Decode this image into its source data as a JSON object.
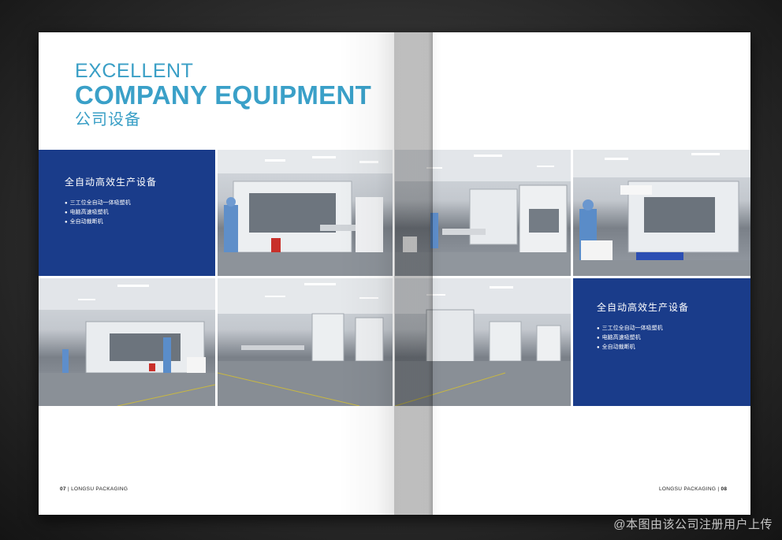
{
  "headline": {
    "line1": "EXCELLENT",
    "line2": "COMPANY EQUIPMENT",
    "line3": "公司设备"
  },
  "panels": [
    {
      "title": "全自动高效生产设备",
      "items": [
        "三工位全自动一体吸塑机",
        "电脑高速吸塑机",
        "全自动裁断机"
      ]
    },
    {
      "title": "全自动高效生产设备",
      "items": [
        "三工位全自动一体吸塑机",
        "电脑高速吸塑机",
        "全自动裁断机"
      ]
    }
  ],
  "footer": {
    "left_page": "07",
    "left_brand": "LONGSU PACKAGING",
    "right_brand": "LONGSU PACKAGING",
    "right_page": "08",
    "separator": "|"
  },
  "watermark": "@本图由该公司注册用户上传",
  "colors": {
    "accent": "#3a9fc6",
    "panel": "#1a3c8a"
  }
}
